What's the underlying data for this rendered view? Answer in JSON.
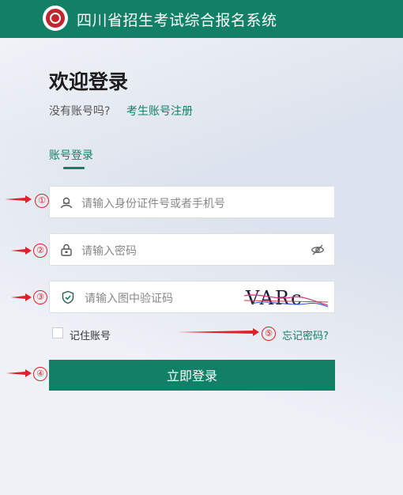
{
  "header": {
    "title": "四川省招生考试综合报名系统"
  },
  "welcome": {
    "title": "欢迎登录",
    "no_account": "没有账号吗?",
    "register_link": "考生账号注册"
  },
  "tabs": [
    {
      "label": "账号登录"
    }
  ],
  "form": {
    "id_field": {
      "placeholder": "请输入身份证件号或者手机号"
    },
    "password_field": {
      "placeholder": "请输入密码"
    },
    "captcha_field": {
      "placeholder": "请输入图中验证码",
      "captcha_text": "VARc"
    },
    "remember_label": "记住账号",
    "forgot_link": "忘记密码?",
    "submit_label": "立即登录"
  },
  "annotations": {
    "markers": [
      "①",
      "②",
      "③",
      "④",
      "⑤"
    ],
    "color": "#e0202a"
  },
  "colors": {
    "brand": "#128066",
    "accent_red": "#c0262d"
  },
  "icons": [
    "logo",
    "user-icon",
    "lock-icon",
    "eye-off-icon",
    "shield-icon"
  ]
}
